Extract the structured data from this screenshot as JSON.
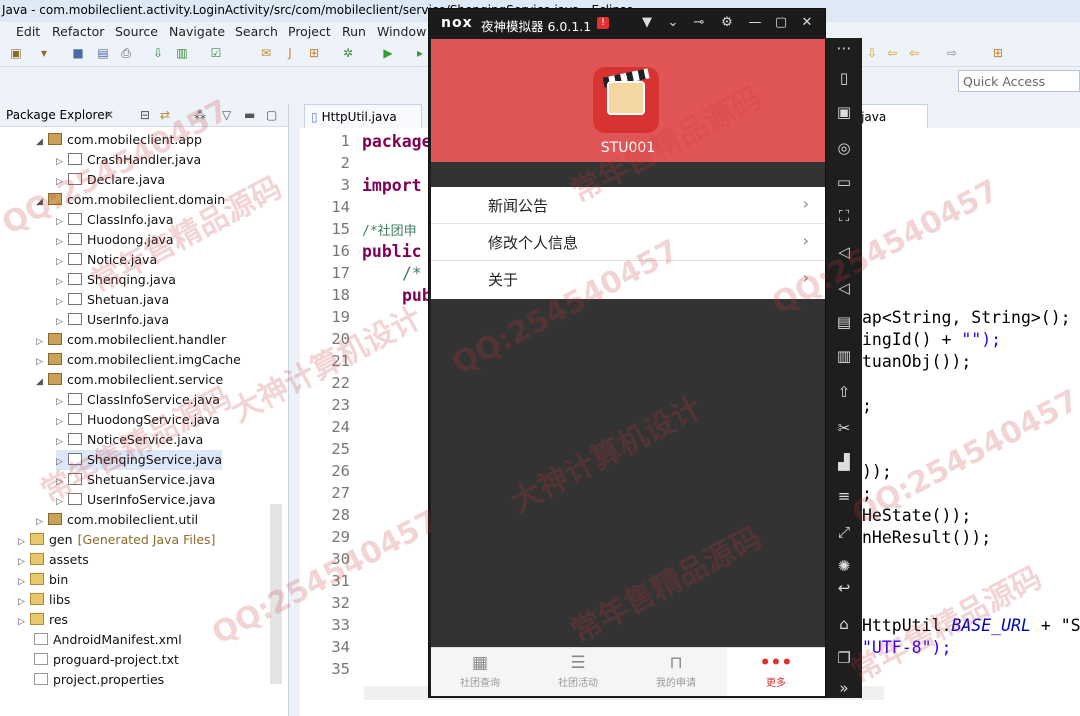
{
  "window": {
    "title": "Java - com.mobileclient.activity.LoginActivity/src/com/mobileclient/service/ShenqingService.java - Eclipse"
  },
  "menubar": [
    "Edit",
    "Refactor",
    "Source",
    "Navigate",
    "Search",
    "Project",
    "Run",
    "Window"
  ],
  "quick_access": {
    "placeholder": "Quick Access"
  },
  "package_explorer": {
    "title": "Package Explorer",
    "tree": [
      {
        "label": "com.mobileclient.app",
        "type": "package",
        "expanded": true
      },
      {
        "label": "CrashHandler.java",
        "type": "java"
      },
      {
        "label": "Declare.java",
        "type": "java"
      },
      {
        "label": "com.mobileclient.domain",
        "type": "package",
        "expanded": true
      },
      {
        "label": "ClassInfo.java",
        "type": "java"
      },
      {
        "label": "Huodong.java",
        "type": "java"
      },
      {
        "label": "Notice.java",
        "type": "java"
      },
      {
        "label": "Shenqing.java",
        "type": "java"
      },
      {
        "label": "Shetuan.java",
        "type": "java"
      },
      {
        "label": "UserInfo.java",
        "type": "java"
      },
      {
        "label": "com.mobileclient.handler",
        "type": "package"
      },
      {
        "label": "com.mobileclient.imgCache",
        "type": "package"
      },
      {
        "label": "com.mobileclient.service",
        "type": "package",
        "expanded": true
      },
      {
        "label": "ClassInfoService.java",
        "type": "java"
      },
      {
        "label": "HuodongService.java",
        "type": "java"
      },
      {
        "label": "NoticeService.java",
        "type": "java"
      },
      {
        "label": "ShenqingService.java",
        "type": "java",
        "selected": true
      },
      {
        "label": "ShetuanService.java",
        "type": "java"
      },
      {
        "label": "UserInfoService.java",
        "type": "java"
      },
      {
        "label": "com.mobileclient.util",
        "type": "package"
      },
      {
        "label": "gen",
        "type": "folder",
        "suffix": "[Generated Java Files]"
      },
      {
        "label": "assets",
        "type": "folder"
      },
      {
        "label": "bin",
        "type": "folder"
      },
      {
        "label": "libs",
        "type": "folder"
      },
      {
        "label": "res",
        "type": "folder"
      },
      {
        "label": "AndroidManifest.xml",
        "type": "file"
      },
      {
        "label": "proguard-project.txt",
        "type": "file"
      },
      {
        "label": "project.properties",
        "type": "file"
      }
    ]
  },
  "editor": {
    "tabs": [
      "HttpUtil.java",
      "rice.java"
    ],
    "line_numbers": [
      "1",
      "2",
      "3",
      "14",
      "15",
      "16",
      "17",
      "18",
      "19",
      "20",
      "21",
      "22",
      "23",
      "24",
      "25",
      "26",
      "27",
      "28",
      "29",
      "30",
      "31",
      "32",
      "33",
      "34",
      "35"
    ],
    "left_code": {
      "l1": "package",
      "l3": "import",
      "l15": "/*社团申",
      "l16": "public",
      "l17": "/*",
      "l18": "pub"
    },
    "right_code": {
      "r19": "ap<String, String>();",
      "r20a": "ingId() + ",
      "r20b": "\"\");",
      "r21": "tuanObj());",
      "r23": ";",
      "r26": "));",
      "r27": ";",
      "r28": "HeState());",
      "r29": "nHeResult());",
      "r33a": "HttpUtil.",
      "r33b": "BASE_URL",
      "r33c": " + \"S",
      "r34": "\"UTF-8\");"
    }
  },
  "emulator": {
    "brand": "nox",
    "title": "夜神模拟器 6.0.1.1",
    "app": {
      "username": "STU001",
      "menu": [
        "新闻公告",
        "修改个人信息",
        "关于"
      ],
      "bottom_nav": [
        "社团查询",
        "社团活动",
        "我的申请",
        "更多"
      ]
    }
  },
  "watermark": [
    "QQ:254540457",
    "大神计算机设计",
    "常年售精品源码"
  ]
}
